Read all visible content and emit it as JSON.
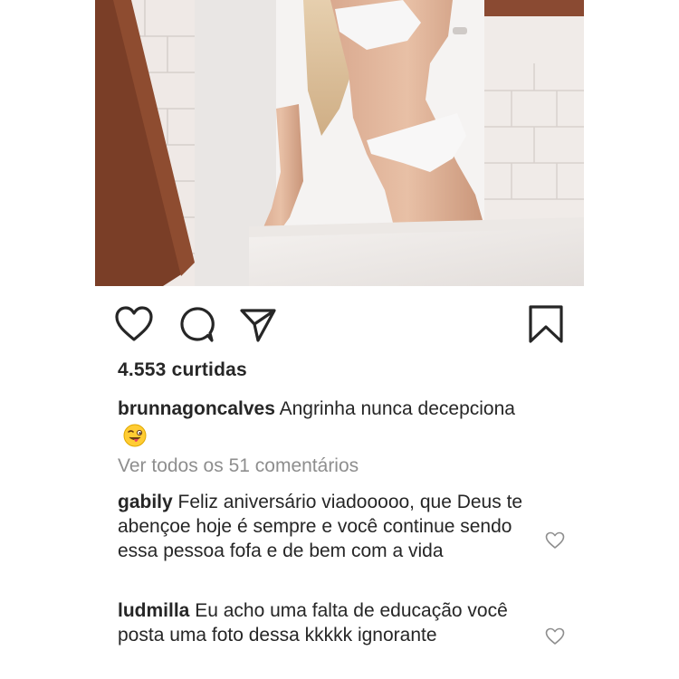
{
  "post": {
    "likes_text": "4.553 curtidas",
    "caption": {
      "username": "brunnagoncalves",
      "text": "Angrinha nunca decepciona",
      "emoji": "winking-face-with-tongue"
    },
    "view_all_comments": "Ver todos os 51 comentários"
  },
  "comments": [
    {
      "username": "gabily",
      "text": "Feliz aniversário viadooooo, que Deus te abençoe hoje é sempre e você continue sendo essa pessoa fofa e de bem com a vida"
    },
    {
      "username": "ludmilla",
      "text": "Eu acho uma falta de educação você posta uma foto dessa kkkkk ignorante"
    }
  ],
  "icons": {
    "like": "heart-icon",
    "comment": "comment-bubble-icon",
    "share": "paper-plane-icon",
    "save": "bookmark-icon",
    "comment_like": "heart-outline-icon"
  },
  "colors": {
    "text": "#262626",
    "muted": "#8e8e8e"
  }
}
